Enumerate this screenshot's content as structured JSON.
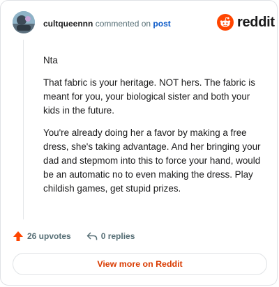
{
  "comment": {
    "username": "cultqueennn",
    "action_text": "commented on",
    "post_link": "post",
    "paragraphs": [
      "Nta",
      "That fabric is your heritage. NOT hers. The fabric is meant for you, your biological sister and both your kids in the future.",
      "You're already doing her a favor by making a free dress, she's taking advantage. And her bringing your dad and stepmom into this to force your hand, would be an automatic no to even making the dress. Play childish games, get stupid prizes."
    ],
    "upvotes_label": "26 upvotes",
    "replies_label": "0 replies"
  },
  "brand": {
    "name": "reddit",
    "color": "#ff4500"
  },
  "cta": {
    "label": "View more on Reddit",
    "color": "#d93a00"
  },
  "icons": {
    "upvote": "upvote-arrow-icon",
    "reply": "reply-arrow-icon"
  }
}
